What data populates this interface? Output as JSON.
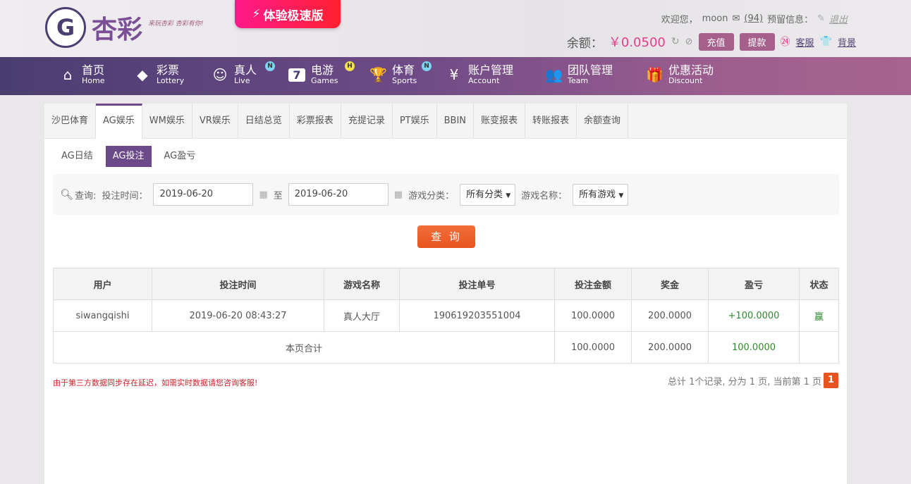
{
  "header": {
    "logo_mark": "G",
    "logo_text": "杏彩",
    "slogan": "来玩杏彩 杏彩有你!",
    "speed_label": "体验极速版",
    "welcome": "欢迎您，",
    "username": "moon",
    "mail_count": "(94)",
    "reserve_label": "预留信息：",
    "logout": "退出",
    "balance_label": "余额：",
    "balance": "￥0.0500",
    "deposit": "充值",
    "withdraw": "提款",
    "service": "客服",
    "background": "背景"
  },
  "nav": [
    {
      "zh": "首页",
      "en": "Home",
      "icon": "home-icon"
    },
    {
      "zh": "彩票",
      "en": "Lottery",
      "icon": "lottery-icon"
    },
    {
      "zh": "真人",
      "en": "Live",
      "icon": "live-icon",
      "badge": "N"
    },
    {
      "zh": "电游",
      "en": "Games",
      "icon": "games-icon",
      "badge": "H"
    },
    {
      "zh": "体育",
      "en": "Sports",
      "icon": "trophy-icon",
      "badge": "N"
    },
    {
      "zh": "账户管理",
      "en": "Account",
      "icon": "account-icon"
    },
    {
      "zh": "团队管理",
      "en": "Team",
      "icon": "team-icon"
    },
    {
      "zh": "优惠活动",
      "en": "Discount",
      "icon": "gift-icon"
    }
  ],
  "tabs": [
    "沙巴体育",
    "AG娱乐",
    "WM娱乐",
    "VR娱乐",
    "日结总览",
    "彩票报表",
    "充提记录",
    "PT娱乐",
    "BBIN",
    "账变报表",
    "转账报表",
    "余额查询"
  ],
  "subtabs": [
    "AG日结",
    "AG投注",
    "AG盈亏"
  ],
  "filter": {
    "query_label": "查询:",
    "time_label": "投注时间：",
    "start": "2019-06-20",
    "to": "至",
    "end": "2019-06-20",
    "category_label": "游戏分类：",
    "category": "所有分类",
    "name_label": "游戏名称：",
    "name": "所有游戏",
    "button": "查 询"
  },
  "table": {
    "headers": [
      "用户",
      "投注时间",
      "游戏名称",
      "投注单号",
      "投注金额",
      "奖金",
      "盈亏",
      "状态"
    ],
    "row": [
      "siwangqishi",
      "2019-06-20 08:43:27",
      "真人大厅",
      "190619203551004",
      "100.0000",
      "200.0000",
      "+100.0000",
      "赢"
    ],
    "total": {
      "label": "本页合计",
      "bet": "100.0000",
      "prize": "200.0000",
      "profit": "100.0000"
    }
  },
  "note": "由于第三方数据同步存在延迟，如需实时数据请您咨询客服!",
  "pager": {
    "summary": "总计 1个记录, 分为 1 页, 当前第 1 页",
    "current": "1"
  }
}
